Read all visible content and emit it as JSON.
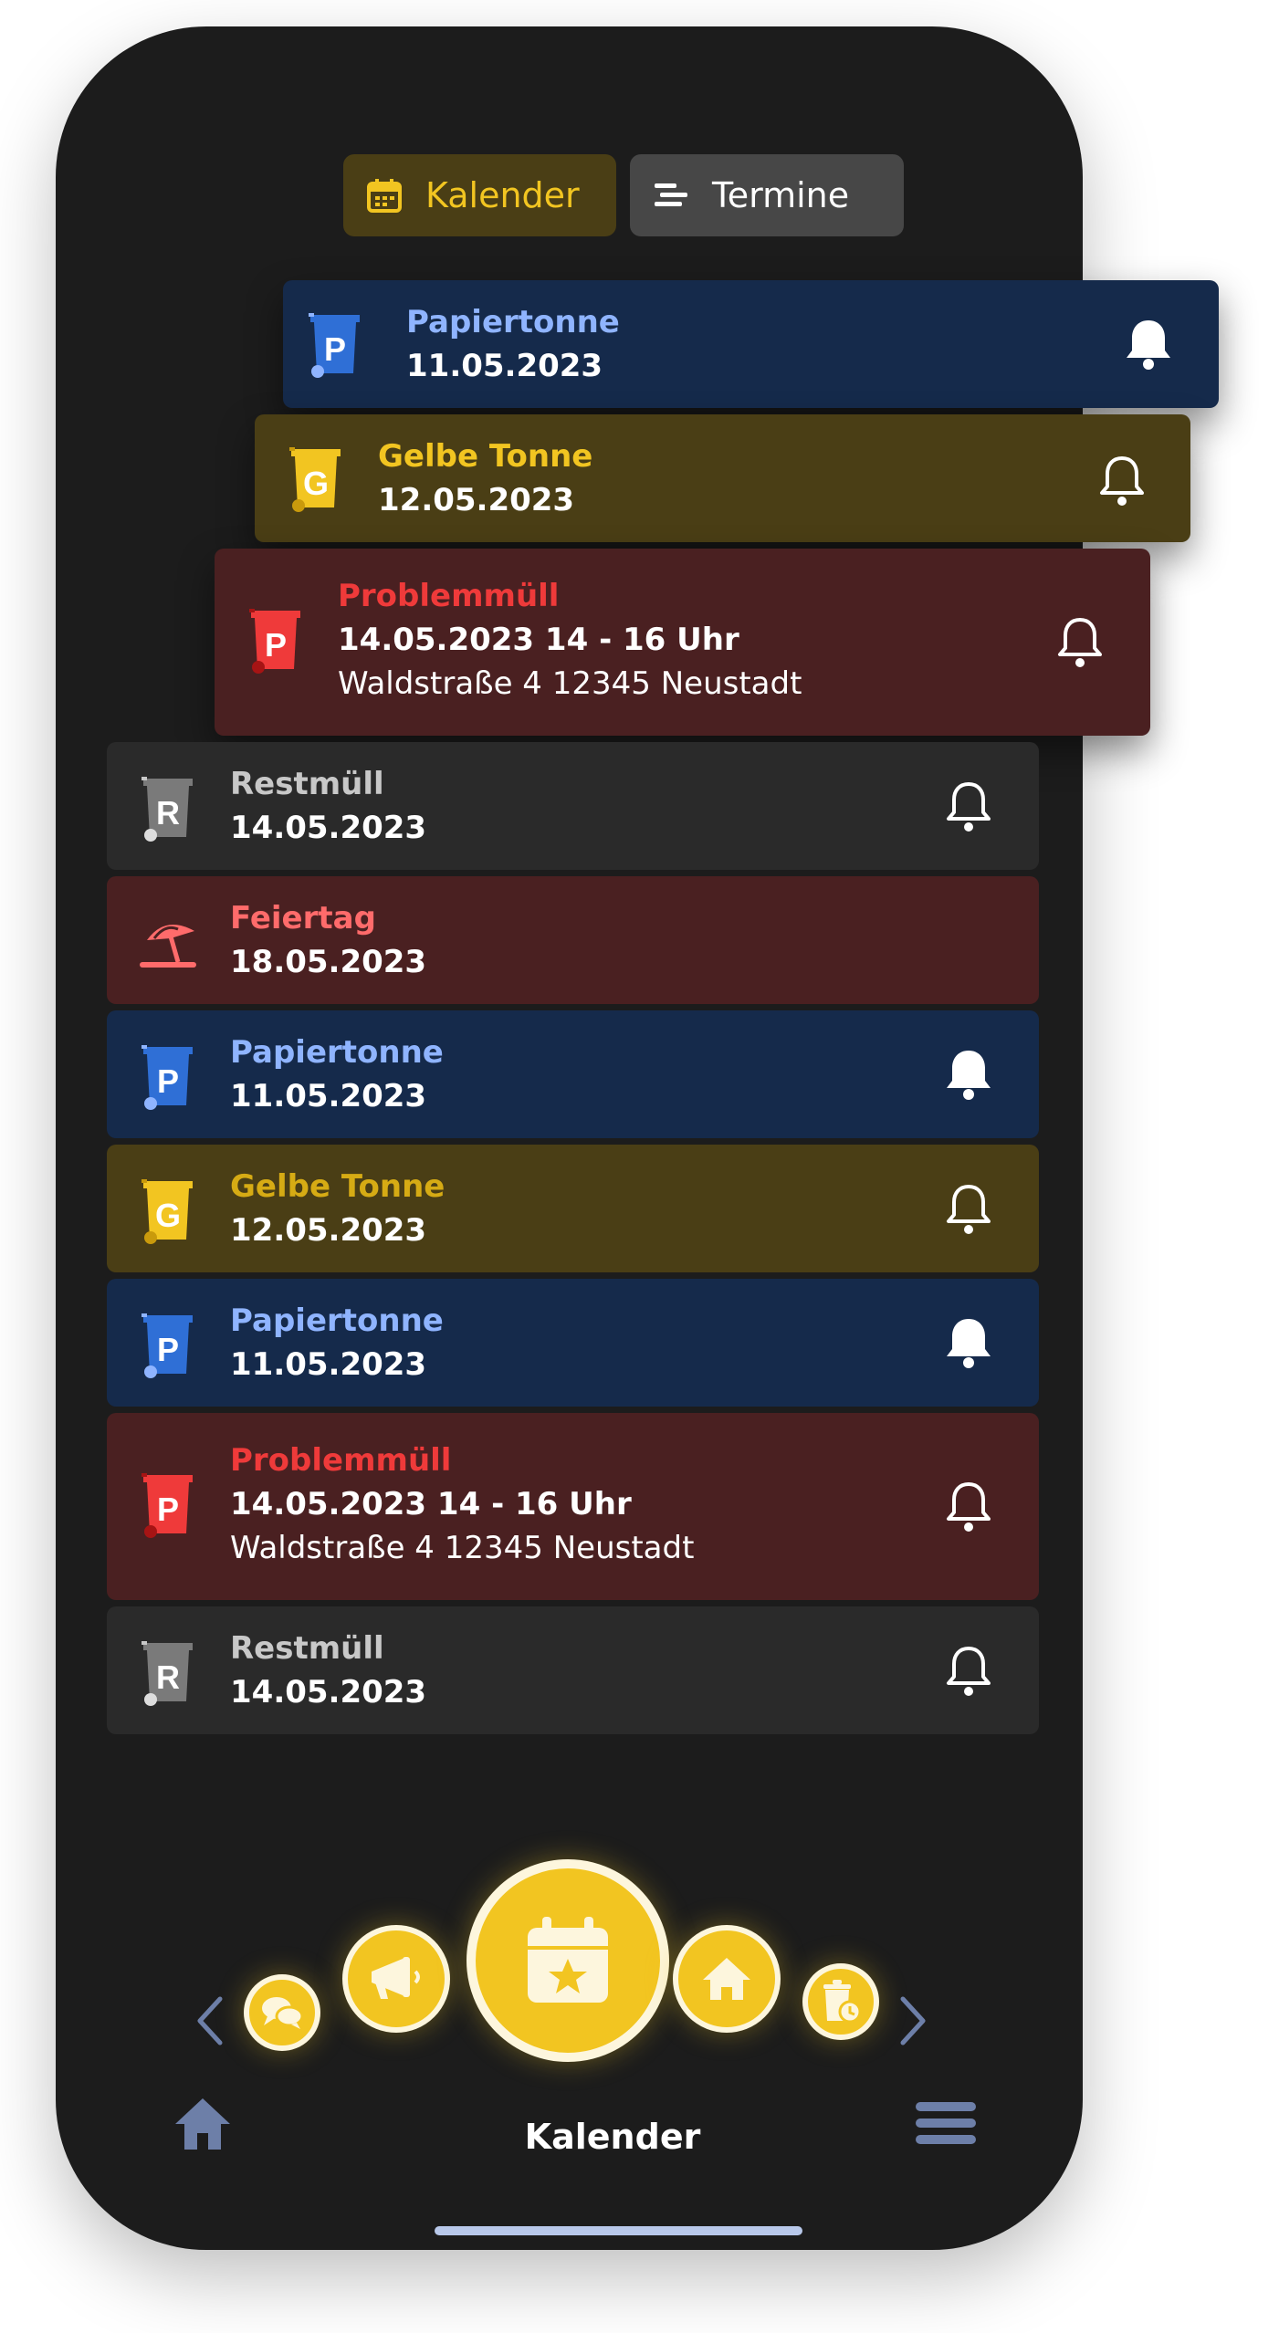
{
  "tabs": {
    "calendar_label": "Kalender",
    "appointments_label": "Termine"
  },
  "floating_cards": [
    {
      "type": "Papiertonne",
      "letter": "P",
      "date": "11.05.2023"
    },
    {
      "type": "Gelbe Tonne",
      "letter": "G",
      "date": "12.05.2023"
    },
    {
      "type": "Problemmüll",
      "letter": "P",
      "date": "14.05.2023 14 - 16 Uhr",
      "address": "Waldstraße 4 12345 Neustadt"
    }
  ],
  "list": [
    {
      "type": "Restmüll",
      "letter": "R",
      "date": "14.05.2023"
    },
    {
      "type": "Feiertag",
      "date": "18.05.2023"
    },
    {
      "type": "Papiertonne",
      "letter": "P",
      "date": "11.05.2023"
    },
    {
      "type": "Gelbe Tonne",
      "letter": "G",
      "date": "12.05.2023"
    },
    {
      "type": "Papiertonne",
      "letter": "P",
      "date": "11.05.2023"
    },
    {
      "type": "Problemmüll",
      "letter": "P",
      "date": "14.05.2023 14 - 16 Uhr",
      "address": "Waldstraße 4 12345 Neustadt"
    },
    {
      "type": "Restmüll",
      "letter": "R",
      "date": "14.05.2023"
    }
  ],
  "bottom_nav": {
    "title": "Kalender",
    "icons": [
      "chevron-left-icon",
      "chat-icon",
      "megaphone-icon",
      "calendar-star-icon",
      "home-icon",
      "bin-clock-icon",
      "chevron-right-icon",
      "home-nav-icon",
      "menu-icon"
    ]
  },
  "colors": {
    "accent": "#f2c521",
    "paper": "#2f6fd6",
    "yellow_bin": "#f2c521",
    "problem": "#ef3a3a",
    "rest": "#7a7a7a"
  }
}
